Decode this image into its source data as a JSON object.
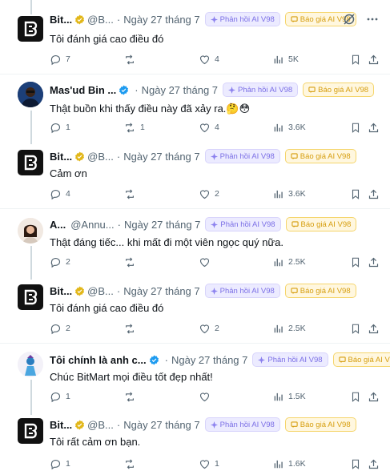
{
  "labels": {
    "ai_reply": "Phản hồi AI V98",
    "price_quote": "Báo giá AI V98"
  },
  "tweets": [
    {
      "name": "Bit...",
      "handle": "@B...",
      "date": "Ngày 27 tháng 7",
      "verified": "gold",
      "text": "Tôi đánh giá cao điều đó",
      "replies": "7",
      "retweets": "",
      "likes": "4",
      "views": "5K"
    },
    {
      "name": "Mas'ud Bin ...",
      "handle": "",
      "date": "Ngày 27 tháng 7",
      "verified": "blue",
      "text": "Thật buồn khi thấy điều này đã xảy ra.🤔😳",
      "replies": "1",
      "retweets": "1",
      "likes": "4",
      "views": "3.6K"
    },
    {
      "name": "Bit...",
      "handle": "@B...",
      "date": "Ngày 27 tháng 7",
      "verified": "gold",
      "text": "Cảm ơn",
      "replies": "4",
      "retweets": "",
      "likes": "2",
      "views": "3.6K"
    },
    {
      "name": "A...",
      "handle": "@Annu...",
      "date": "Ngày 27 tháng 7",
      "verified": "none",
      "text": "Thật đáng tiếc... khi mất đi một viên ngọc quý nữa.",
      "replies": "2",
      "retweets": "",
      "likes": "",
      "views": "2.5K"
    },
    {
      "name": "Bit...",
      "handle": "@B...",
      "date": "Ngày 27 tháng 7",
      "verified": "gold",
      "text": "Tôi đánh giá cao điều đó",
      "replies": "2",
      "retweets": "",
      "likes": "2",
      "views": "2.5K"
    },
    {
      "name": "Tôi chính là anh c...",
      "handle": "",
      "date": "Ngày 27 tháng 7",
      "verified": "blue",
      "text": "Chúc BitMart mọi điều tốt đẹp nhất!",
      "replies": "1",
      "retweets": "",
      "likes": "",
      "views": "1.5K"
    },
    {
      "name": "Bit...",
      "handle": "@B...",
      "date": "Ngày 27 tháng 7",
      "verified": "gold",
      "text": "Tôi rất cảm ơn bạn.",
      "replies": "1",
      "retweets": "",
      "likes": "1",
      "views": "1.6K"
    }
  ]
}
